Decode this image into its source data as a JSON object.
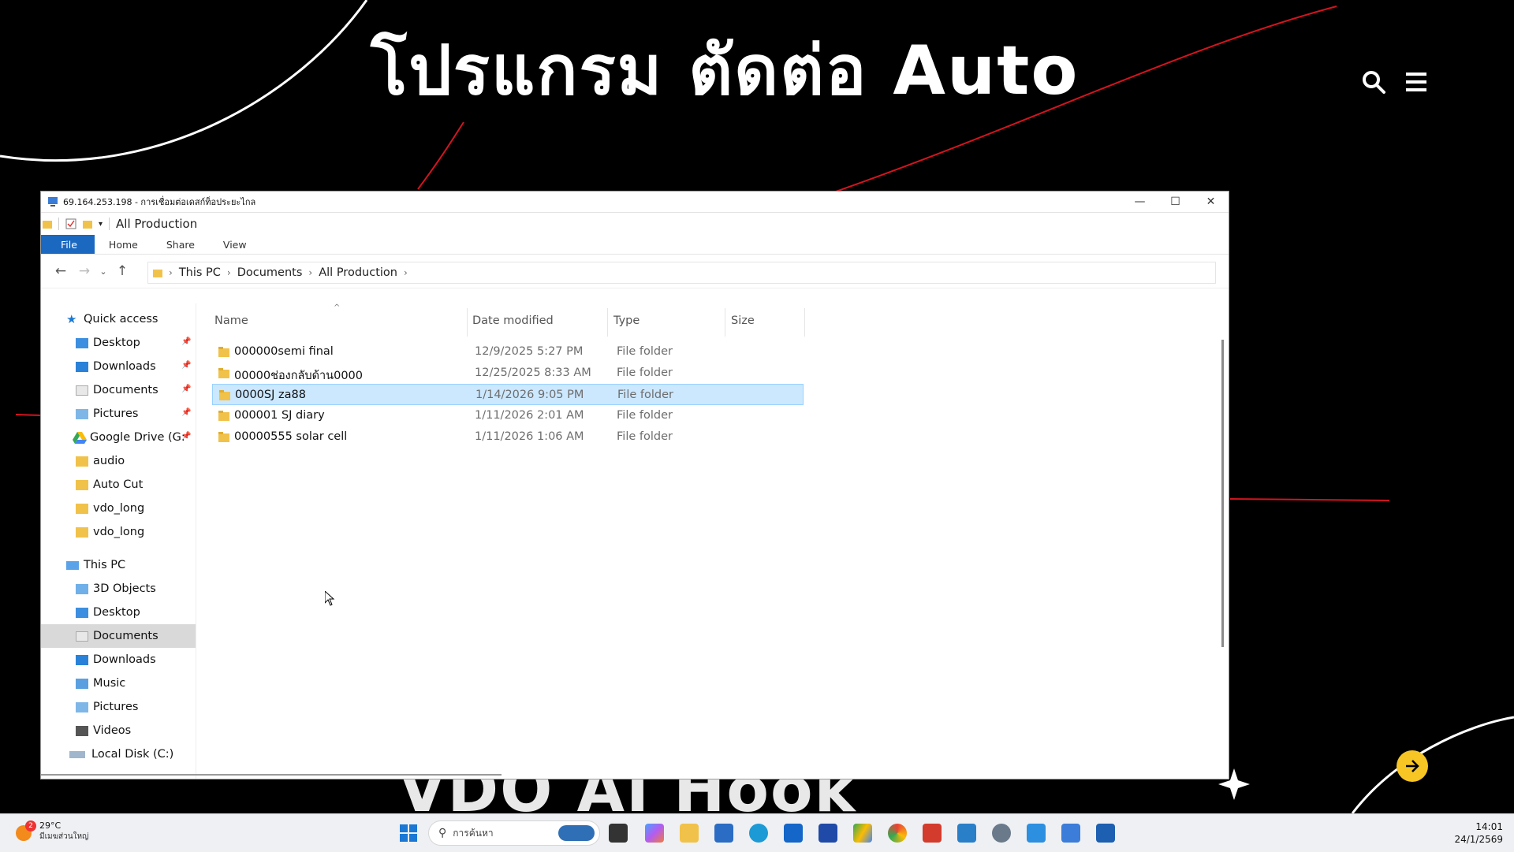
{
  "banner": {
    "title": "โปรแกรม ตัดต่อ Auto",
    "bottom_text": "VDO  AI Hook"
  },
  "window": {
    "rdp_title": "69.164.253.198 - การเชื่อมต่อเดสก์ท็อประยะไกล",
    "qat_title": "All Production",
    "controls": {
      "minimize": "—",
      "maximize": "☐",
      "close": "✕"
    }
  },
  "ribbon": {
    "tabs": [
      "File",
      "Home",
      "Share",
      "View"
    ]
  },
  "address": {
    "crumbs": [
      "This PC",
      "Documents",
      "All Production"
    ]
  },
  "nav": {
    "quick_access": "Quick access",
    "quick_items": [
      "Desktop",
      "Downloads",
      "Documents",
      "Pictures",
      "Google Drive (G:",
      "audio",
      "Auto Cut",
      "vdo_long",
      "vdo_long"
    ],
    "this_pc": "This PC",
    "pc_items": [
      "3D Objects",
      "Desktop",
      "Documents",
      "Downloads",
      "Music",
      "Pictures",
      "Videos",
      "Local Disk (C:)"
    ]
  },
  "columns": {
    "name": "Name",
    "date": "Date modified",
    "type": "Type",
    "size": "Size"
  },
  "files": [
    {
      "name": "000000semi final",
      "date": "12/9/2025 5:27 PM",
      "type": "File folder"
    },
    {
      "name": "00000ช่องกลับด้าน0000",
      "date": "12/25/2025 8:33 AM",
      "type": "File folder"
    },
    {
      "name": "0000SJ za88",
      "date": "1/14/2026 9:05 PM",
      "type": "File folder"
    },
    {
      "name": "000001 SJ diary",
      "date": "1/11/2026 2:01 AM",
      "type": "File folder"
    },
    {
      "name": "00000555 solar cell",
      "date": "1/11/2026 1:06 AM",
      "type": "File folder"
    }
  ],
  "taskbar": {
    "temp": "29°C",
    "condition": "มีเมฆส่วนใหญ่",
    "weather_badge": "2",
    "search_placeholder": "การค้นหา",
    "time": "14:01",
    "date": "24/1/2569"
  },
  "colors": {
    "accent": "#1a68c0",
    "selection": "#cce8ff",
    "folder": "#f1c24a",
    "arrow_button": "#f7c624"
  }
}
